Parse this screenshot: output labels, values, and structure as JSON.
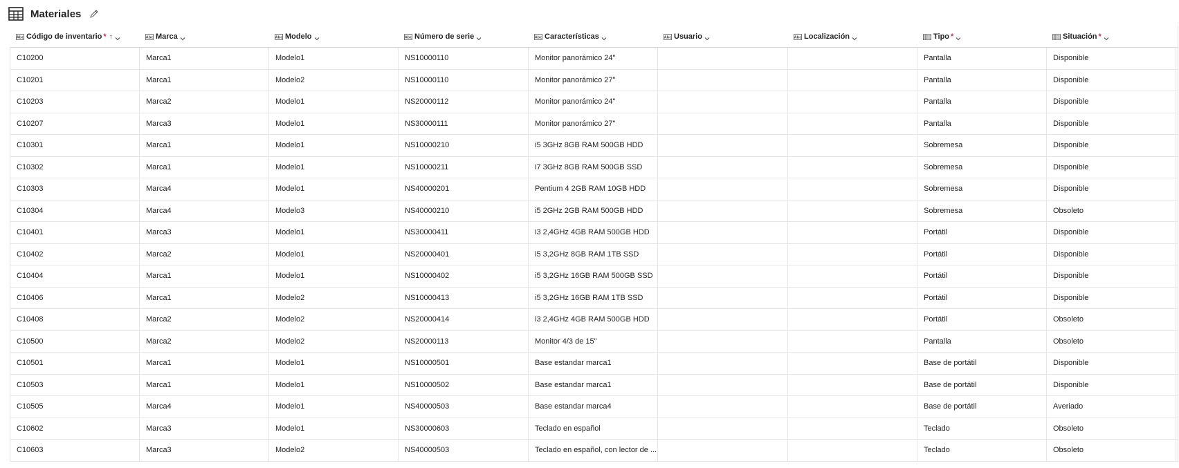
{
  "title": "Materiales",
  "columns": [
    {
      "label": "Código de inventario",
      "required": true,
      "sorted": "↑",
      "icon": "text-column-icon"
    },
    {
      "label": "Marca",
      "required": false,
      "icon": "text-column-icon"
    },
    {
      "label": "Modelo",
      "required": false,
      "icon": "text-column-icon"
    },
    {
      "label": "Número de serie",
      "required": false,
      "icon": "text-column-icon"
    },
    {
      "label": "Características",
      "required": false,
      "icon": "text-column-icon"
    },
    {
      "label": "Usuario",
      "required": false,
      "icon": "text-column-icon"
    },
    {
      "label": "Localización",
      "required": false,
      "icon": "text-column-icon"
    },
    {
      "label": "Tipo",
      "required": true,
      "icon": "choice-column-icon"
    },
    {
      "label": "Situación",
      "required": true,
      "icon": "choice-column-icon"
    }
  ],
  "rows": [
    [
      "C10200",
      "Marca1",
      "Modelo1",
      "NS10000110",
      "Monitor panorámico 24\"",
      "",
      "",
      "Pantalla",
      "Disponible"
    ],
    [
      "C10201",
      "Marca1",
      "Modelo2",
      "NS10000110",
      "Monitor panorámico 27\"",
      "",
      "",
      "Pantalla",
      "Disponible"
    ],
    [
      "C10203",
      "Marca2",
      "Modelo1",
      "NS20000112",
      "Monitor panorámico 24\"",
      "",
      "",
      "Pantalla",
      "Disponible"
    ],
    [
      "C10207",
      "Marca3",
      "Modelo1",
      "NS30000111",
      "Monitor panorámico 27\"",
      "",
      "",
      "Pantalla",
      "Disponible"
    ],
    [
      "C10301",
      "Marca1",
      "Modelo1",
      "NS10000210",
      "i5 3GHz 8GB RAM 500GB HDD",
      "",
      "",
      "Sobremesa",
      "Disponible"
    ],
    [
      "C10302",
      "Marca1",
      "Modelo1",
      "NS10000211",
      "i7 3GHz 8GB RAM 500GB SSD",
      "",
      "",
      "Sobremesa",
      "Disponible"
    ],
    [
      "C10303",
      "Marca4",
      "Modelo1",
      "NS40000201",
      "Pentium 4 2GB RAM 10GB HDD",
      "",
      "",
      "Sobremesa",
      "Disponible"
    ],
    [
      "C10304",
      "Marca4",
      "Modelo3",
      "NS40000210",
      "i5 2GHz 2GB RAM 500GB HDD",
      "",
      "",
      "Sobremesa",
      "Obsoleto"
    ],
    [
      "C10401",
      "Marca3",
      "Modelo1",
      "NS30000411",
      "i3 2,4GHz 4GB RAM 500GB HDD",
      "",
      "",
      "Portátil",
      "Disponible"
    ],
    [
      "C10402",
      "Marca2",
      "Modelo1",
      "NS20000401",
      "i5 3,2GHz 8GB RAM 1TB SSD",
      "",
      "",
      "Portátil",
      "Disponible"
    ],
    [
      "C10404",
      "Marca1",
      "Modelo1",
      "NS10000402",
      "i5 3,2GHz 16GB RAM 500GB SSD",
      "",
      "",
      "Portátil",
      "Disponible"
    ],
    [
      "C10406",
      "Marca1",
      "Modelo2",
      "NS10000413",
      "i5 3,2GHz 16GB RAM 1TB SSD",
      "",
      "",
      "Portátil",
      "Disponible"
    ],
    [
      "C10408",
      "Marca2",
      "Modelo2",
      "NS20000414",
      "i3 2,4GHz 4GB RAM 500GB HDD",
      "",
      "",
      "Portátil",
      "Obsoleto"
    ],
    [
      "C10500",
      "Marca2",
      "Modelo2",
      "NS20000113",
      "Monitor 4/3 de 15\"",
      "",
      "",
      "Pantalla",
      "Obsoleto"
    ],
    [
      "C10501",
      "Marca1",
      "Modelo1",
      "NS10000501",
      "Base estandar marca1",
      "",
      "",
      "Base de portátil",
      "Disponible"
    ],
    [
      "C10503",
      "Marca1",
      "Modelo1",
      "NS10000502",
      "Base estandar marca1",
      "",
      "",
      "Base de portátil",
      "Disponible"
    ],
    [
      "C10505",
      "Marca4",
      "Modelo1",
      "NS40000503",
      "Base estandar marca4",
      "",
      "",
      "Base de portátil",
      "Averiado"
    ],
    [
      "C10602",
      "Marca3",
      "Modelo1",
      "NS30000603",
      "Teclado en español",
      "",
      "",
      "Teclado",
      "Obsoleto"
    ],
    [
      "C10603",
      "Marca3",
      "Modelo2",
      "NS40000503",
      "Teclado en español, con lector de ...",
      "",
      "",
      "Teclado",
      "Obsoleto"
    ]
  ],
  "colors": {
    "required_marker": "#c4314b",
    "border": "#e6e6e6",
    "text": "#242424"
  }
}
